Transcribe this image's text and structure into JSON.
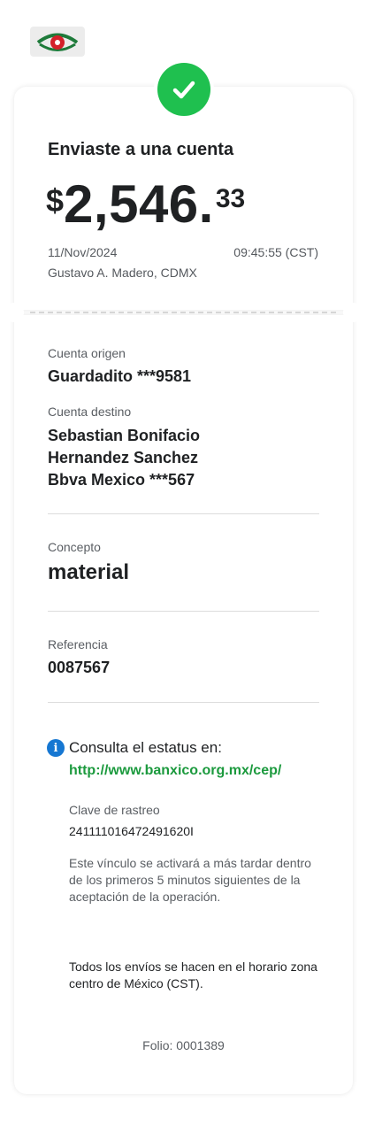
{
  "header": {
    "logo_icon": "banxico-eye-logo-icon"
  },
  "receipt": {
    "status_icon": "check-icon",
    "status_color": "#1fc04f",
    "title": "Enviaste a una cuenta",
    "amount": {
      "currency": "$",
      "integer": "2,546.",
      "decimals": "33"
    },
    "date": "11/Nov/2024",
    "time": "09:45:55 (CST)",
    "location": "Gustavo A. Madero, CDMX"
  },
  "details": {
    "origin_label": "Cuenta origen",
    "origin_value": "Guardadito ***9581",
    "destination_label": "Cuenta destino",
    "destination_lines": [
      "Sebastian Bonifacio",
      "Hernandez Sanchez",
      "Bbva Mexico ***567"
    ],
    "concept_label": "Concepto",
    "concept_value": "material",
    "reference_label": "Referencia",
    "reference_value": "0087567"
  },
  "status_info": {
    "icon": "info-icon",
    "icon_color": "#1677d2",
    "text": "Consulta el estatus en:",
    "link": "http://www.banxico.org.mx/cep/",
    "link_color": "#1c9a3e",
    "tracking_label": "Clave de rastreo",
    "tracking_value": "241111016472491620I",
    "note": "Este vínculo se activará a más tardar dentro de los primeros 5 minutos siguientes de la aceptación de la operación.",
    "timezone_note": "Todos los envíos se hacen en el horario zona centro de México (CST)."
  },
  "footer": {
    "folio": "Folio: 0001389"
  }
}
